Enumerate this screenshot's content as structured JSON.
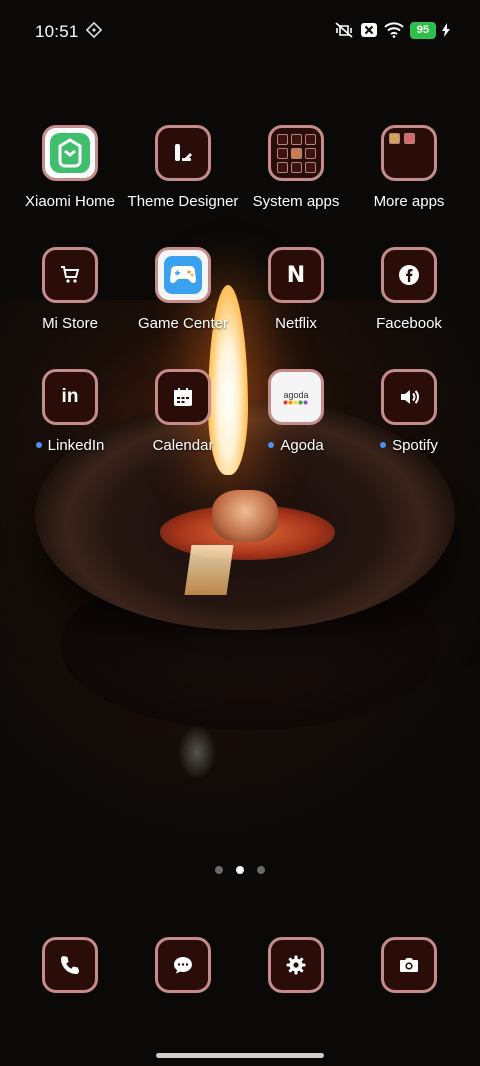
{
  "status_bar": {
    "time": "10:51",
    "battery_level": "95",
    "icons": [
      "sync-diamond-icon",
      "mute-vibrate-icon",
      "sim-disabled-icon",
      "wifi-icon",
      "battery-icon",
      "charging-icon"
    ]
  },
  "home": {
    "rows": [
      [
        {
          "label": "Xiaomi Home",
          "icon": "xiaomi-home-icon",
          "new": false
        },
        {
          "label": "Theme Designer",
          "icon": "theme-designer-icon",
          "new": false
        },
        {
          "label": "System apps",
          "icon": "folder-icon",
          "new": false
        },
        {
          "label": "More apps",
          "icon": "folder-icon",
          "new": false
        }
      ],
      [
        {
          "label": "Mi Store",
          "icon": "cart-icon",
          "new": false
        },
        {
          "label": "Game Center",
          "icon": "gamepad-icon",
          "new": false
        },
        {
          "label": "Netflix",
          "icon": "netflix-icon",
          "new": false
        },
        {
          "label": "Facebook",
          "icon": "facebook-icon",
          "new": false
        }
      ],
      [
        {
          "label": "LinkedIn",
          "icon": "linkedin-icon",
          "new": true
        },
        {
          "label": "Calendar",
          "icon": "calendar-icon",
          "new": false
        },
        {
          "label": "Agoda",
          "icon": "agoda-icon",
          "new": true
        },
        {
          "label": "Spotify",
          "icon": "speaker-icon",
          "new": true
        }
      ]
    ],
    "agoda_logo_text": "agoda",
    "netflix_letter": "N",
    "linkedin_text": "in",
    "page_count": 3,
    "active_page": 2
  },
  "dock": [
    {
      "icon": "phone-icon"
    },
    {
      "icon": "messages-icon"
    },
    {
      "icon": "settings-icon"
    },
    {
      "icon": "camera-icon"
    }
  ],
  "colors": {
    "icon_background": "#2a0d08",
    "icon_border": "#c48c8a",
    "battery": "#2fbd4b",
    "notification_dot": "#4c8ff5"
  }
}
